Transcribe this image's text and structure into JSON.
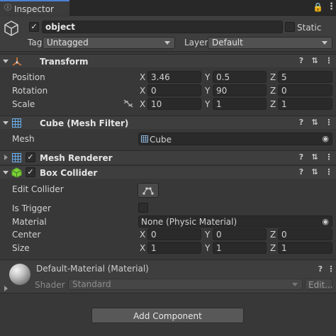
{
  "tab": {
    "title": "Inspector"
  },
  "gameobject": {
    "active": true,
    "name": "object",
    "static_label": "Static",
    "tag_label": "Tag",
    "tag_value": "Untagged",
    "layer_label": "Layer",
    "layer_value": "Default"
  },
  "transform": {
    "title": "Transform",
    "rows": [
      {
        "label": "Position",
        "x": "3.46",
        "y": "0.5",
        "z": "5"
      },
      {
        "label": "Rotation",
        "x": "0",
        "y": "90",
        "z": "0"
      },
      {
        "label": "Scale",
        "x": "10",
        "y": "1",
        "z": "1"
      }
    ]
  },
  "mesh_filter": {
    "title": "Cube (Mesh Filter)",
    "mesh_label": "Mesh",
    "mesh_value": "Cube"
  },
  "mesh_renderer": {
    "title": "Mesh Renderer",
    "enabled": true
  },
  "box_collider": {
    "title": "Box Collider",
    "enabled": true,
    "edit_label": "Edit Collider",
    "trigger_label": "Is Trigger",
    "material_label": "Material",
    "material_value": "None (Physic Material)",
    "center": {
      "label": "Center",
      "x": "0",
      "y": "0",
      "z": "0"
    },
    "size": {
      "label": "Size",
      "x": "1",
      "y": "1",
      "z": "1"
    }
  },
  "material": {
    "title": "Default-Material (Material)",
    "shader_label": "Shader",
    "shader_value": "Standard",
    "edit_label": "Edit..."
  },
  "footer": {
    "add_component": "Add Component"
  },
  "axes": {
    "x": "X",
    "y": "Y",
    "z": "Z"
  },
  "colors": {
    "background": "#383838",
    "header": "#3e3e3e",
    "field": "#2a2a2a",
    "accent_green": "#7ecf3a"
  }
}
